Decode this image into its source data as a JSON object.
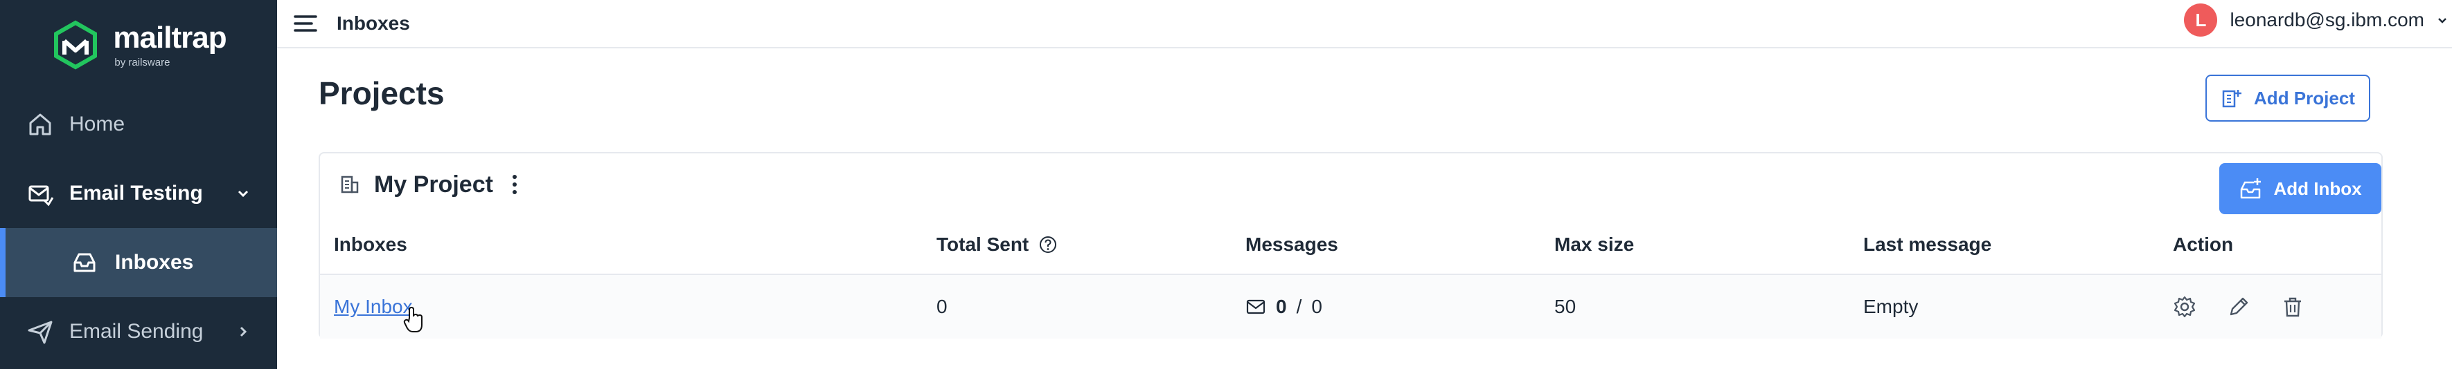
{
  "brand": {
    "name": "mailtrap",
    "sub": "by railsware",
    "accent": "#4b8cf5",
    "sidebar_bg": "#1c2b3a"
  },
  "sidebar": {
    "items": [
      {
        "label": "Home",
        "icon": "home-icon"
      },
      {
        "label": "Email Testing",
        "icon": "email-testing-icon",
        "chevron": "chevron-down-icon"
      },
      {
        "label": "Inboxes",
        "icon": "inbox-icon"
      },
      {
        "label": "Email Sending",
        "icon": "send-icon",
        "chevron": "chevron-right-icon"
      }
    ]
  },
  "topbar": {
    "title": "Inboxes",
    "user_initial": "L",
    "user_email": "leonardb@sg.ibm.com"
  },
  "page": {
    "title": "Projects",
    "add_project_label": "Add Project"
  },
  "project": {
    "name": "My Project",
    "add_inbox_label": "Add Inbox",
    "columns": [
      "Inboxes",
      "Total Sent",
      "Messages",
      "Max size",
      "Last message",
      "Action"
    ],
    "rows": [
      {
        "inbox": "My Inbox",
        "total_sent": "0",
        "messages_unread": "0",
        "messages_sep": "/",
        "messages_total": "0",
        "max_size": "50",
        "last_message": "Empty"
      }
    ]
  }
}
